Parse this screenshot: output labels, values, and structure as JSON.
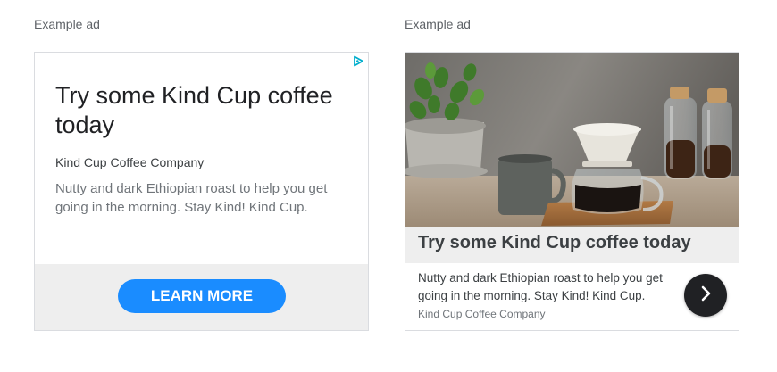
{
  "captions": {
    "left": "Example ad",
    "right": "Example ad"
  },
  "ad_left": {
    "headline": "Try some Kind Cup coffee today",
    "advertiser": "Kind Cup Coffee Company",
    "description": "Nutty and dark Ethiopian roast to help you get going in the morning. Stay Kind! Kind Cup.",
    "cta_label": "LEARN MORE",
    "adchoices_icon": "adchoices-icon"
  },
  "ad_right": {
    "headline": "Try some Kind Cup coffee today",
    "description": "Nutty and dark Ethiopian roast to help you get going in the morning. Stay Kind! Kind Cup.",
    "advertiser": "Kind Cup Coffee Company",
    "arrow_icon": "chevron-right-icon",
    "image": "coffee-pour-over-photo"
  },
  "colors": {
    "cta_blue": "#1a8cff",
    "footer_gray": "#eeeeee",
    "arrow_bg": "#202124"
  }
}
